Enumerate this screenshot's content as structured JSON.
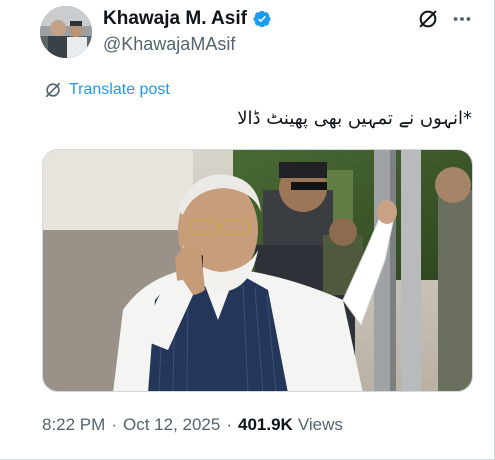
{
  "author": {
    "display_name": "Khawaja M. Asif",
    "handle": "@KhawajaMAsif",
    "verified": true,
    "verified_color": "#1d9bf0"
  },
  "actions": {
    "grok_icon": "grok-slash-circle-icon",
    "more_icon": "more-horizontal-icon"
  },
  "translate": {
    "label": "Translate post",
    "icon": "translate-slash-circle-icon",
    "color": "#1d9bf0"
  },
  "post": {
    "text": "*انہوں نے تمہیں بھی پھینٹ ڈالا"
  },
  "media": {
    "type": "photo"
  },
  "meta": {
    "time": "8:22 PM",
    "separator": "·",
    "date": "Oct 12, 2025",
    "views_count": "401.9K",
    "views_label": "Views"
  },
  "colors": {
    "text_primary": "#0f1419",
    "text_secondary": "#536471",
    "border": "#cfd9de"
  }
}
